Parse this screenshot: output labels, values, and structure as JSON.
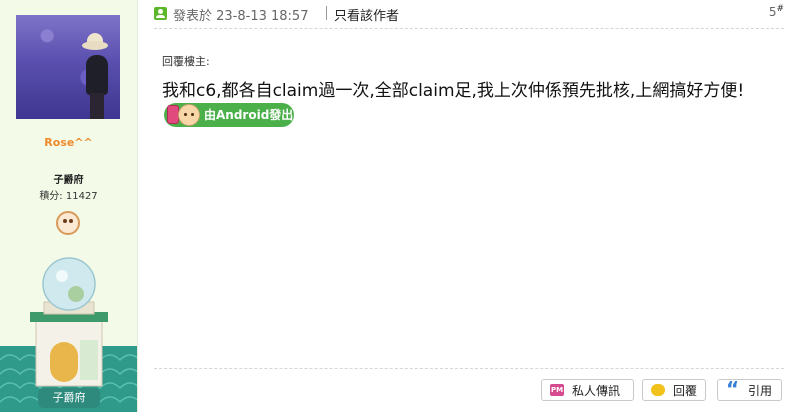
{
  "profile": {
    "username": "Rose^^",
    "rank_title": "子爵府",
    "points": "積分: 11427",
    "rank_badge_label": "子爵府"
  },
  "post": {
    "date": "發表於 23-8-13 18:57",
    "author_only_label": "只看該作者",
    "floor_number": "5",
    "floor_symbol": "#",
    "quote_label": "回覆樓主:",
    "body_text": "我和c6,都各自claim過一次,全部claim足,我上次仲係預先批核,上網搞好方便!",
    "source_badge": "由Android發出"
  },
  "actions": {
    "pm_label": "私人傳訊",
    "reply_label": "回覆",
    "quote_label": "引用"
  },
  "colors": {
    "username": "#ee8a2b",
    "sidebar_bg": "#f3fbe8",
    "android_badge": "#4cb04a",
    "rank_caption_bg": "#2d8a7d"
  }
}
